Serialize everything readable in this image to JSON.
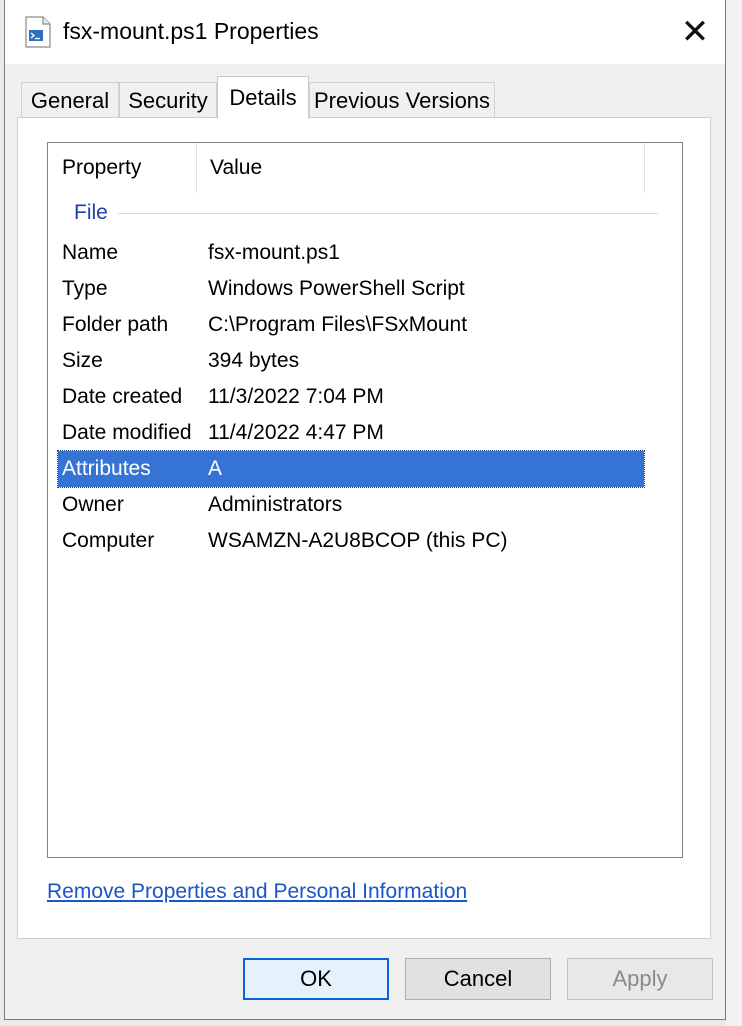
{
  "window": {
    "title": "fsx-mount.ps1 Properties",
    "close_glyph": "✕",
    "file_icon": "powershell-script-file-icon"
  },
  "tabs": [
    {
      "label": "General",
      "active": false
    },
    {
      "label": "Security",
      "active": false
    },
    {
      "label": "Details",
      "active": true
    },
    {
      "label": "Previous Versions",
      "active": false
    }
  ],
  "details": {
    "columns": {
      "property": "Property",
      "value": "Value"
    },
    "group": "File",
    "rows": [
      {
        "property": "Name",
        "value": "fsx-mount.ps1",
        "selected": false
      },
      {
        "property": "Type",
        "value": "Windows PowerShell Script",
        "selected": false
      },
      {
        "property": "Folder path",
        "value": "C:\\Program Files\\FSxMount",
        "selected": false
      },
      {
        "property": "Size",
        "value": "394 bytes",
        "selected": false
      },
      {
        "property": "Date created",
        "value": "11/3/2022 7:04 PM",
        "selected": false
      },
      {
        "property": "Date modified",
        "value": "11/4/2022 4:47 PM",
        "selected": false
      },
      {
        "property": "Attributes",
        "value": "A",
        "selected": true
      },
      {
        "property": "Owner",
        "value": "Administrators",
        "selected": false
      },
      {
        "property": "Computer",
        "value": "WSAMZN-A2U8BCOP (this PC)",
        "selected": false
      }
    ]
  },
  "remove_link": "Remove Properties and Personal Information",
  "buttons": {
    "ok": "OK",
    "cancel": "Cancel",
    "apply": "Apply"
  },
  "colors": {
    "selection": "#3574d4",
    "link": "#1a56c6",
    "group_label": "#1f3fa8"
  }
}
